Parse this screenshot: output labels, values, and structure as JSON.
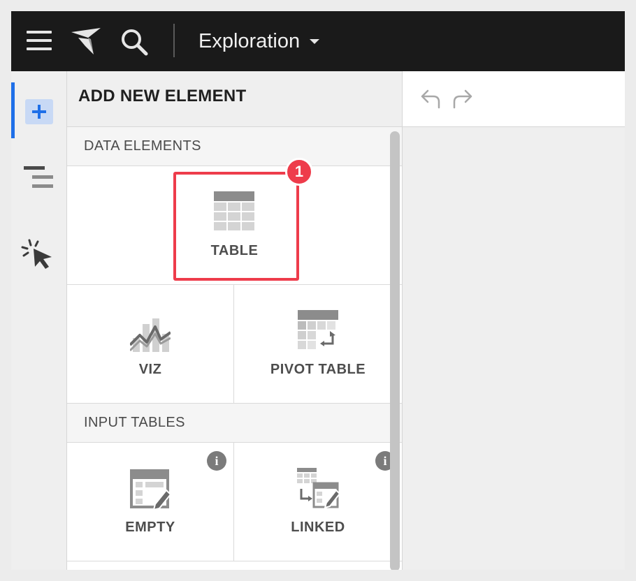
{
  "topbar": {
    "title": "Exploration",
    "icons": [
      "menu-icon",
      "logo-icon",
      "search-icon",
      "caret-down-icon"
    ]
  },
  "rail": {
    "icons": [
      "add-icon",
      "outline-icon",
      "interaction-icon"
    ],
    "active": "add-icon",
    "accent_color": "#1f6fe8"
  },
  "panel": {
    "title": "ADD NEW ELEMENT",
    "sections": [
      {
        "heading": "DATA ELEMENTS",
        "tiles": [
          {
            "label": "TABLE",
            "icon": "table-icon"
          },
          {
            "label": "VIZ",
            "icon": "viz-icon"
          },
          {
            "label": "PIVOT TABLE",
            "icon": "pivot-table-icon"
          }
        ]
      },
      {
        "heading": "INPUT TABLES",
        "tiles": [
          {
            "label": "EMPTY",
            "icon": "empty-input-table-icon",
            "info": "i"
          },
          {
            "label": "LINKED",
            "icon": "linked-input-table-icon",
            "info": "i"
          }
        ]
      }
    ]
  },
  "annotation": {
    "step_number": "1",
    "color": "#ee3c4b"
  },
  "canvas": {
    "icons": [
      "undo-icon",
      "redo-icon"
    ]
  }
}
